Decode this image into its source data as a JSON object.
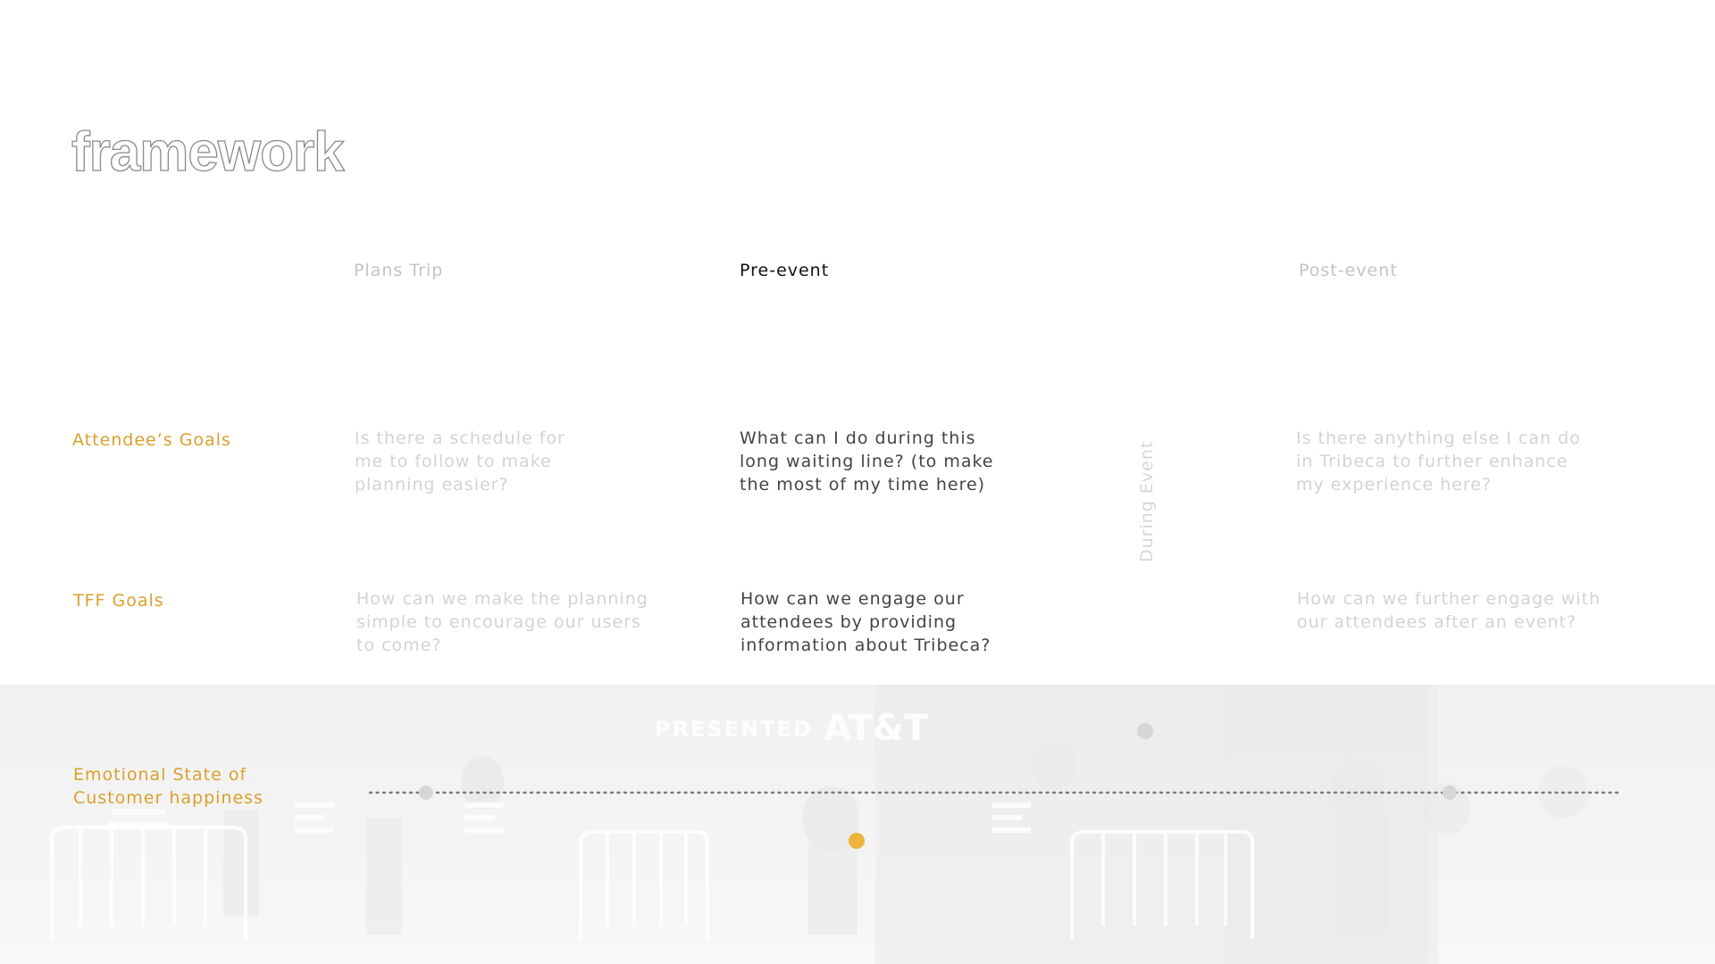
{
  "title": "framework",
  "phases": {
    "plans_trip": "Plans Trip",
    "pre_event": "Pre-event",
    "during_event": "During Event",
    "post_event": "Post-event"
  },
  "rows": {
    "attendee_goals": {
      "label": "Attendee’s Goals",
      "plans_trip": "Is there a schedule for me to follow to make planning easier?",
      "pre_event": "What can I do during this long waiting line? (to make the most of my time here)",
      "post_event": "Is there anything else I can do in Tribeca to further enhance my experience here?"
    },
    "tff_goals": {
      "label": "TFF Goals",
      "plans_trip": "How can we make the planning simple to encourage our users to come?",
      "pre_event": "How can we engage our attendees by providing information about Tribeca?",
      "post_event": "How can we further engage with our attendees after an event?"
    },
    "emotional_state": {
      "label": "Emotional State of Customer happiness"
    }
  },
  "background_text": {
    "presented": "PRESENTED",
    "sponsor": "AT&T"
  },
  "colors": {
    "accent": "#d9a02d",
    "active_dot": "#ecb43a",
    "inactive_dot": "#d6d6d6",
    "muted_text": "#d3d3d3",
    "active_text": "#444444"
  }
}
